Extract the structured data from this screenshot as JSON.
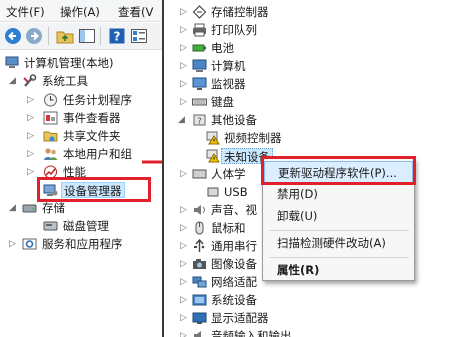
{
  "menubar": {
    "items": [
      "文件(F)",
      "操作(A)",
      "查看(V"
    ]
  },
  "left_tree": {
    "root": "计算机管理(本地)",
    "system_tools": "系统工具",
    "children": [
      "任务计划程序",
      "事件查看器",
      "共享文件夹",
      "本地用户和组",
      "性能",
      "设备管理器"
    ],
    "storage": "存储",
    "disk_management": "磁盘管理",
    "services": "服务和应用程序"
  },
  "device_tree": {
    "items": [
      "存储控制器",
      "打印队列",
      "电池",
      "计算机",
      "监视器",
      "键盘",
      "其他设备"
    ],
    "other_children": [
      "视频控制器",
      "未知设备"
    ],
    "after": [
      "人体学",
      "USB",
      "声音、视",
      "鼠标和",
      "通用串行",
      "图像设备",
      "网络适配",
      "系统设备",
      "显示适配器",
      "音频输入和输出"
    ]
  },
  "context_menu": {
    "update_driver": "更新驱动程序软件(P)...",
    "disable": "禁用(D)",
    "uninstall": "卸载(U)",
    "scan": "扫描检测硬件改动(A)",
    "properties": "属性(R)"
  },
  "colors": {
    "accent": "#e0202a",
    "selection": "#cce8ff"
  }
}
